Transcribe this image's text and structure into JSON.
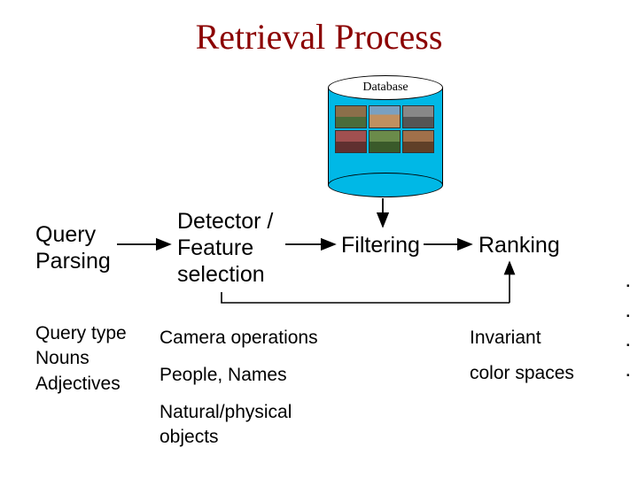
{
  "title": "Retrieval Process",
  "database_label": "Database",
  "nodes": {
    "query_parsing": "Query\nParsing",
    "detector": "Detector /\nFeature\nselection",
    "filtering": "Filtering",
    "ranking": "Ranking"
  },
  "query_attributes": "Query type\nNouns\nAdjectives",
  "feature_examples": {
    "camera": "Camera operations",
    "people": "People, Names",
    "natural": "Natural/physical\nobjects"
  },
  "ranking_details": {
    "invariant": "Invariant",
    "colorspaces": "color spaces"
  }
}
